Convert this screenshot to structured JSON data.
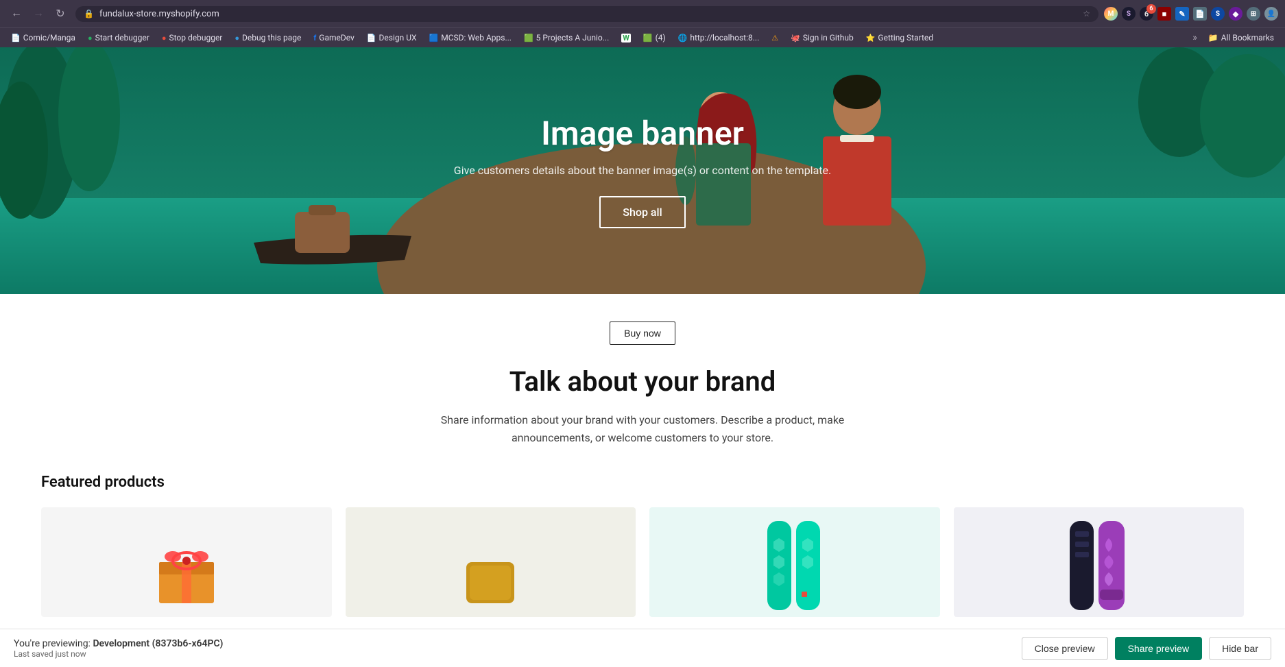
{
  "browser": {
    "url": "fundalux-store.myshopify.com",
    "url_icon": "🔒",
    "nav": {
      "back_disabled": false,
      "forward_disabled": false
    },
    "extensions": [
      {
        "id": "ext-multicolor",
        "label": "M",
        "color": "#e91e8c",
        "bg": "linear-gradient(135deg,#ff6b,#fec,#48d,#ff9)"
      },
      {
        "id": "ext-s",
        "label": "S",
        "color": "#6c63ff"
      },
      {
        "id": "ext-badge-6",
        "label": "6",
        "color": "#e74c3c",
        "badge": "6"
      },
      {
        "id": "ext-red-box",
        "label": "■",
        "color": "#c0392b"
      },
      {
        "id": "ext-edit",
        "label": "✎",
        "color": "#2980b9"
      },
      {
        "id": "ext-doc",
        "label": "📄",
        "color": "#95a5a6"
      },
      {
        "id": "ext-s2",
        "label": "S",
        "color": "#3498db"
      },
      {
        "id": "ext-diamond",
        "label": "◆",
        "color": "#9b59b6"
      },
      {
        "id": "ext-puzzle",
        "label": "🧩",
        "color": "#7f8c8d"
      },
      {
        "id": "ext-person",
        "label": "👤",
        "color": "#bdc3c7"
      }
    ],
    "bookmarks": [
      {
        "label": "Comic/Manga",
        "icon": "📄"
      },
      {
        "label": "Start debugger",
        "icon": "●"
      },
      {
        "label": "Stop debugger",
        "icon": "●"
      },
      {
        "label": "Debug this page",
        "icon": "●"
      },
      {
        "label": "GameDev",
        "icon": "f"
      },
      {
        "label": "Design UX",
        "icon": "📄"
      },
      {
        "label": "MCSD: Web Apps...",
        "icon": "🟦"
      },
      {
        "label": "5 Projects A Junio...",
        "icon": "🟩"
      },
      {
        "label": "W",
        "icon": "W"
      },
      {
        "label": "(4)",
        "icon": "🟩"
      },
      {
        "label": "http://localhost:8...",
        "icon": "🌐"
      },
      {
        "label": "⚠",
        "icon": "⚠"
      },
      {
        "label": "Sign in Github",
        "icon": "🐙"
      },
      {
        "label": "Getting Started",
        "icon": "⭐"
      },
      {
        "label": "»",
        "icon": ""
      },
      {
        "label": "All Bookmarks",
        "icon": "📁"
      }
    ]
  },
  "hero": {
    "title": "Image banner",
    "subtitle": "Give customers details about the banner image(s) or content on the template.",
    "cta_label": "Shop all"
  },
  "main": {
    "buy_now_label": "Buy now",
    "brand_title": "Talk about your brand",
    "brand_subtitle": "Share information about your brand with your customers. Describe a product, make announcements, or welcome customers to your store.",
    "featured_products_title": "Featured products"
  },
  "preview_bar": {
    "previewing_label": "You're previewing:",
    "env_name": "Development (8373b6-x64PC)",
    "saved_label": "Last saved just now",
    "close_label": "Close preview",
    "share_label": "Share preview",
    "hide_label": "Hide bar"
  },
  "products": [
    {
      "id": "product-1",
      "type": "gift-box",
      "color": "#f0a030"
    },
    {
      "id": "product-2",
      "type": "soap-bar",
      "color": "#c89020"
    },
    {
      "id": "product-3",
      "type": "snowboard-teal",
      "color": "#00c8a0"
    },
    {
      "id": "product-4",
      "type": "snowboard-dark",
      "color": "#2a2a3a"
    }
  ]
}
